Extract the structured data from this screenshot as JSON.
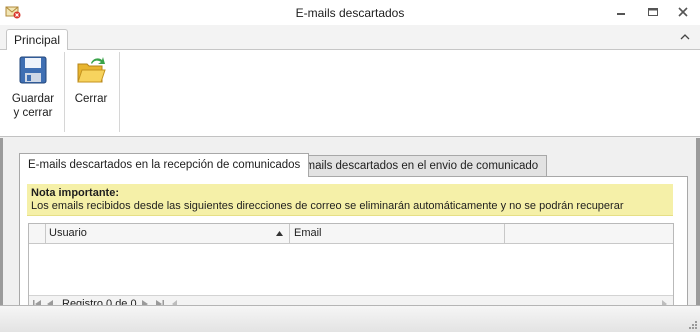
{
  "window": {
    "title": "E-mails descartados"
  },
  "ribbon": {
    "tabs": [
      {
        "label": "Principal"
      }
    ],
    "buttons": [
      {
        "label_line1": "Guardar",
        "label_line2": "y cerrar",
        "icon": "floppy-disk-icon"
      },
      {
        "label_line1": "Cerrar",
        "icon": "open-folder-arrow-icon"
      }
    ]
  },
  "tabs": [
    {
      "label": "E-mails descartados en la recepción de comunicados",
      "active": true
    },
    {
      "label": "E-mails descartados en el envio de comunicado",
      "active": false
    }
  ],
  "note": {
    "heading": "Nota importante:",
    "text": "Los emails recibidos desde las siguientes direcciones de correo se eliminarán automáticamente y no se podrán recuperar"
  },
  "grid": {
    "columns": [
      {
        "label": "Usuario",
        "sorted": "asc"
      },
      {
        "label": "Email"
      }
    ],
    "rows": [],
    "navigator": {
      "record_text": "Registro 0 de 0"
    }
  },
  "colors": {
    "note_background": "#f5f0a8",
    "frame": "#9b9b9b"
  }
}
